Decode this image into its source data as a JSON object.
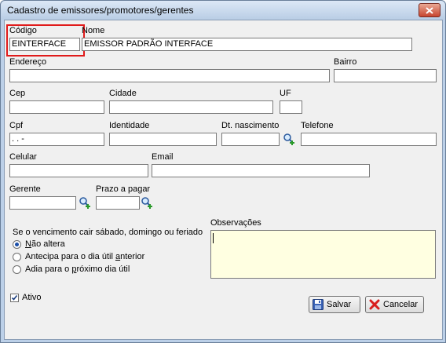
{
  "window": {
    "title": "Cadastro de emissores/promotores/gerentes"
  },
  "fields": {
    "codigo": {
      "label": "Código",
      "value": "EINTERFACE"
    },
    "nome": {
      "label": "Nome",
      "value": "EMISSOR PADRÃO INTERFACE"
    },
    "endereco": {
      "label": "Endereço",
      "value": ""
    },
    "bairro": {
      "label": "Bairro",
      "value": ""
    },
    "cep": {
      "label": "Cep",
      "value": ""
    },
    "cidade": {
      "label": "Cidade",
      "value": ""
    },
    "uf": {
      "label": "UF",
      "value": ""
    },
    "cpf": {
      "label": "Cpf",
      "value": " .   .   -"
    },
    "identidade": {
      "label": "Identidade",
      "value": ""
    },
    "dt_nascimento": {
      "label": "Dt. nascimento",
      "value": ""
    },
    "telefone": {
      "label": "Telefone",
      "value": ""
    },
    "celular": {
      "label": "Celular",
      "value": ""
    },
    "email": {
      "label": "Email",
      "value": ""
    },
    "gerente": {
      "label": "Gerente",
      "value": ""
    },
    "prazo": {
      "label": "Prazo a pagar",
      "value": ""
    },
    "observacoes": {
      "label": "Observações",
      "value": ""
    }
  },
  "weekend_rule": {
    "caption": "Se o vencimento cair sábado, domingo ou feriado",
    "options": [
      {
        "pre": "",
        "ul": "N",
        "post": "ão altera",
        "selected": true
      },
      {
        "pre": "Antecipa para o dia útil ",
        "ul": "a",
        "post": "nterior",
        "selected": false
      },
      {
        "pre": "Adia para o ",
        "ul": "p",
        "post": "róximo dia útil",
        "selected": false
      }
    ]
  },
  "ativo": {
    "label": "Ativo",
    "checked": true
  },
  "buttons": {
    "salvar": {
      "label": "Salvar",
      "icon": "floppy-disk-icon"
    },
    "cancelar": {
      "label": "Cancelar",
      "icon": "red-x-icon"
    }
  },
  "colors": {
    "highlight": "#e01b1b",
    "observacoes_bg": "#ffffe1"
  }
}
